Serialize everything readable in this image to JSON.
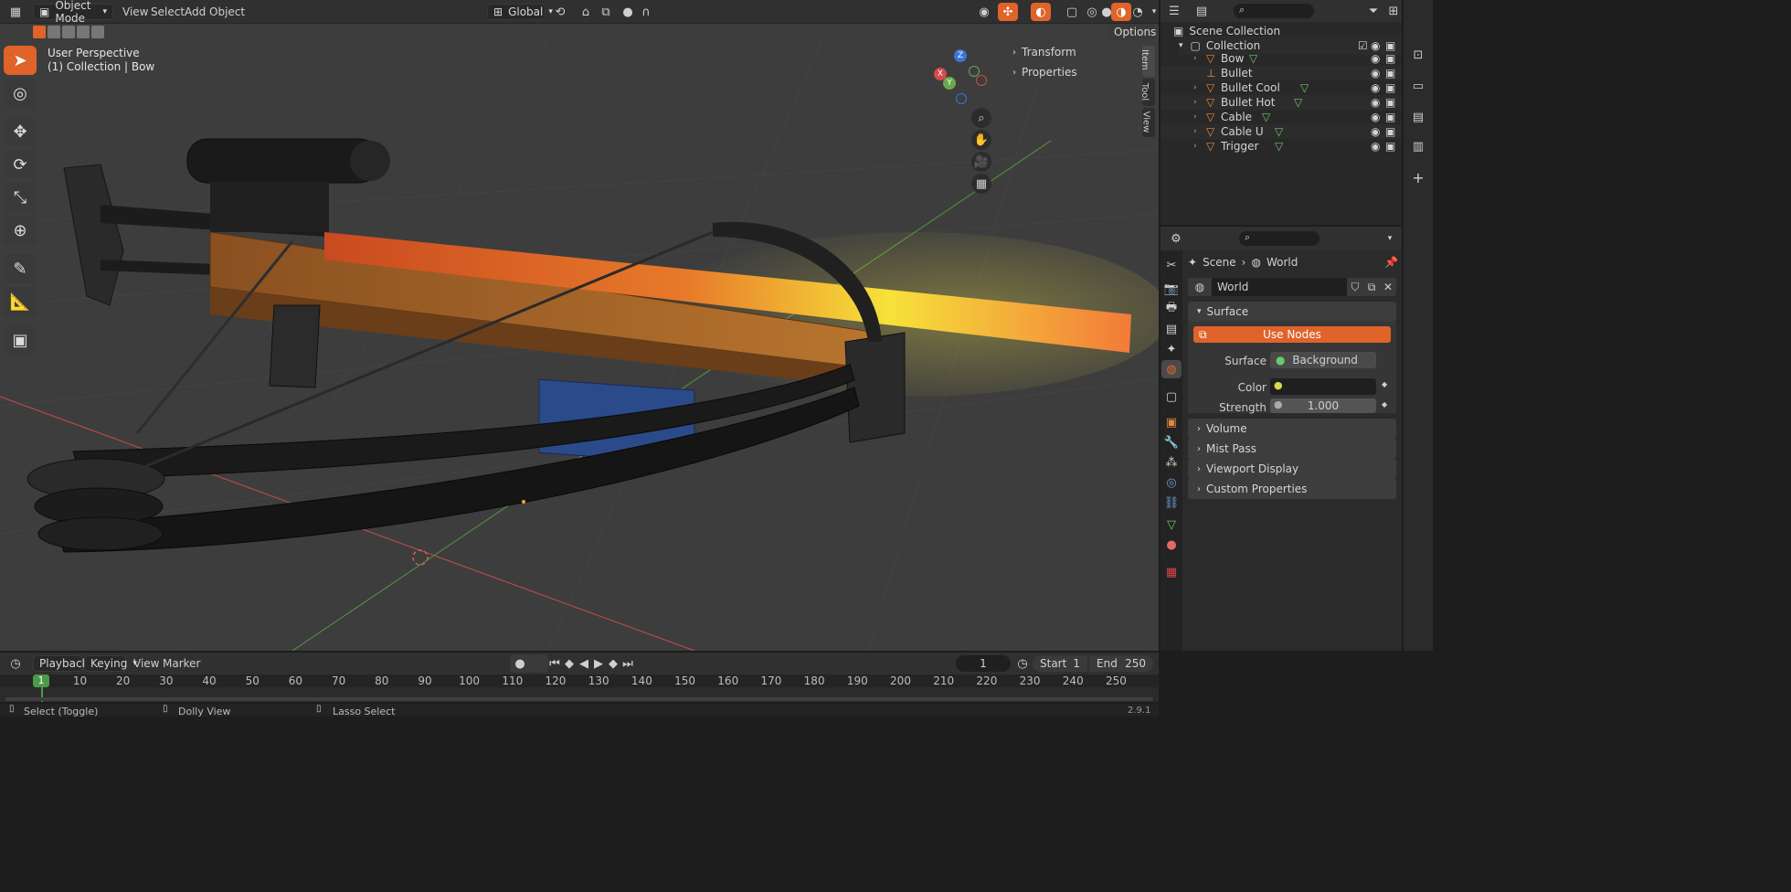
{
  "header": {
    "mode": "Object Mode",
    "menus": [
      "View",
      "Select",
      "Add",
      "Object"
    ],
    "orientation": "Global",
    "options_label": "Options"
  },
  "viewport": {
    "perspective_label": "User Perspective",
    "collection_label": "(1) Collection | Bow",
    "npanel": {
      "sections": [
        "Transform",
        "Properties"
      ],
      "tabs": [
        "Item",
        "Tool",
        "View"
      ]
    },
    "gizmo": {
      "x": "X",
      "y": "Y",
      "z": "Z"
    }
  },
  "outliner": {
    "scene_collection": "Scene Collection",
    "collection": "Collection",
    "items": [
      {
        "name": "Bow",
        "expandable": true
      },
      {
        "name": "Bullet",
        "expandable": false
      },
      {
        "name": "Bullet Cool",
        "expandable": true
      },
      {
        "name": "Bullet Hot",
        "expandable": true
      },
      {
        "name": "Cable",
        "expandable": true
      },
      {
        "name": "Cable U",
        "expandable": true
      },
      {
        "name": "Trigger",
        "expandable": true
      }
    ]
  },
  "properties": {
    "breadcrumb": {
      "scene": "Scene",
      "world": "World"
    },
    "world_name": "World",
    "surface_panel": "Surface",
    "use_nodes_label": "Use Nodes",
    "surface_label": "Surface",
    "surface_value": "Background",
    "color_label": "Color",
    "strength_label": "Strength",
    "strength_value": "1.000",
    "collapsed_panels": [
      "Volume",
      "Mist Pass",
      "Viewport Display",
      "Custom Properties"
    ]
  },
  "timeline": {
    "menus": [
      "Playback",
      "Keying",
      "View",
      "Marker"
    ],
    "current_frame": "1",
    "start_label": "Start",
    "start_value": "1",
    "end_label": "End",
    "end_value": "250",
    "ticks": [
      "1",
      "10",
      "20",
      "30",
      "40",
      "50",
      "60",
      "70",
      "80",
      "90",
      "100",
      "110",
      "120",
      "130",
      "140",
      "150",
      "160",
      "170",
      "180",
      "190",
      "200",
      "210",
      "220",
      "230",
      "240",
      "250"
    ]
  },
  "statusbar": {
    "items": [
      "Select (Toggle)",
      "Dolly View",
      "Lasso Select"
    ],
    "version": "2.9.1"
  },
  "colors": {
    "accent": "#e0632a",
    "panel": "#303030",
    "viewport": "#3d3d3d"
  }
}
